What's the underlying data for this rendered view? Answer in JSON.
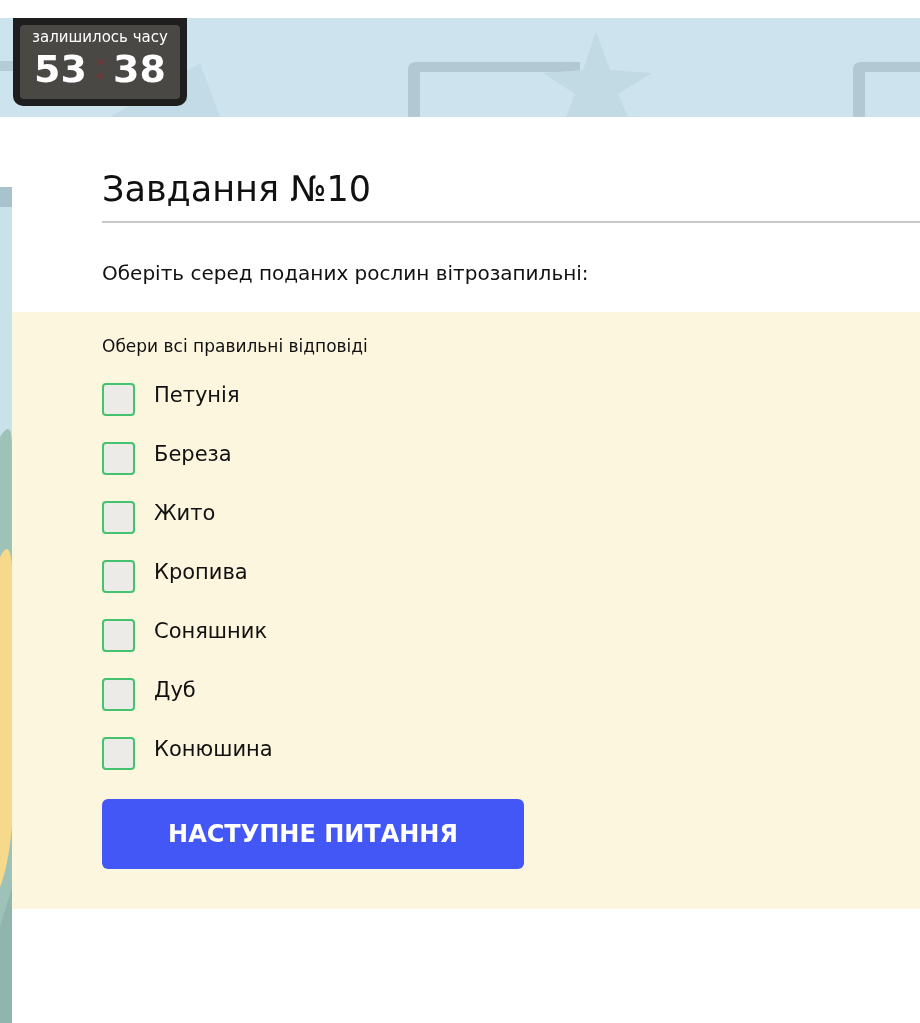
{
  "timer": {
    "caption": "залишилось часу",
    "minutes": "53",
    "seconds": "38"
  },
  "task": {
    "title": "Завдання №10",
    "question": "Оберіть серед поданих рослин вітрозапильні:"
  },
  "answers": {
    "instruction": "Обери всі правильні відповіді",
    "options": [
      {
        "label": "Петунія",
        "checked": false
      },
      {
        "label": "Береза",
        "checked": false
      },
      {
        "label": "Жито",
        "checked": false
      },
      {
        "label": "Кропива",
        "checked": false
      },
      {
        "label": "Соняшник",
        "checked": false
      },
      {
        "label": "Дуб",
        "checked": false
      },
      {
        "label": "Конюшина",
        "checked": false
      }
    ]
  },
  "next_button": {
    "label": "НАСТУПНЕ ПИТАННЯ"
  }
}
